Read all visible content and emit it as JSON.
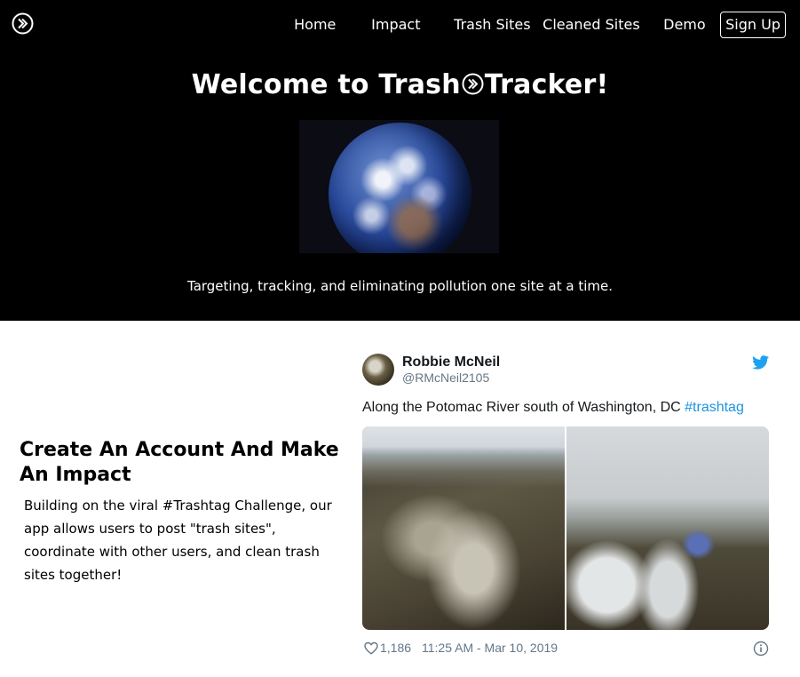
{
  "nav": {
    "home": "Home",
    "impact": "Impact",
    "trash_sites": "Trash Sites",
    "cleaned_sites": "Cleaned Sites",
    "demo": "Demo",
    "signup": "Sign Up"
  },
  "hero": {
    "title_before": "Welcome to Trash",
    "title_after": "Tracker!",
    "tagline": "Targeting, tracking, and eliminating pollution one site at a time."
  },
  "cta": {
    "heading": "Create An Account And Make An Impact",
    "body": "Building on the viral #Trashtag Challenge, our app allows users to post \"trash sites\", coordinate with other users, and clean trash sites together!"
  },
  "tweet": {
    "author_name": "Robbie McNeil",
    "author_handle": "@RMcNeil2105",
    "text": "Along the Potomac River south of Washington, DC ",
    "hashtag": "#trashtag",
    "likes": "1,186",
    "timestamp": "11:25 AM - Mar 10, 2019"
  },
  "icons": {
    "logo": "circle-double-chevron-icon",
    "twitter": "twitter-bird-icon",
    "like": "heart-icon",
    "info": "info-icon"
  },
  "colors": {
    "hero_bg": "#000000",
    "hashtag": "#1b95e0",
    "twitter_blue": "#1da1f2",
    "muted_text": "#657786"
  }
}
